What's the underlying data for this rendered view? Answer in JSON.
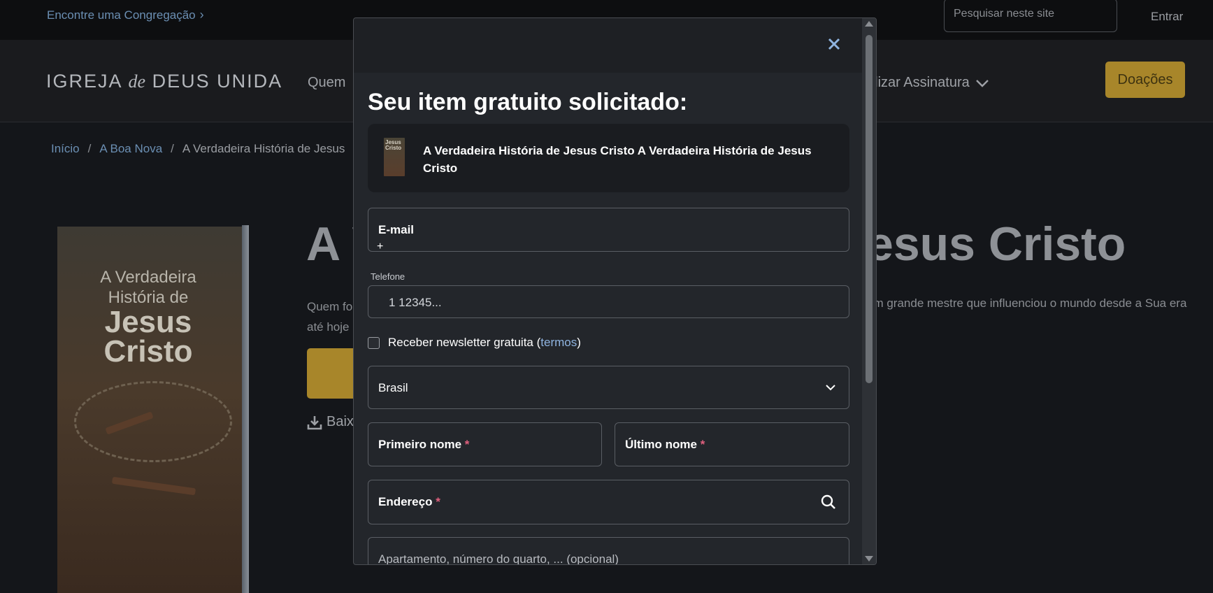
{
  "topbar": {
    "congregation_link": "Encontre uma Congregação",
    "search_placeholder": "Pesquisar neste site",
    "login": "Entrar"
  },
  "nav": {
    "logo_a": "IGREJA",
    "logo_de": "de",
    "logo_b": "DEUS UNIDA",
    "item_quem": "Quem",
    "item_assinatura": "alizar Assinatura",
    "donate": "Doações"
  },
  "breadcrumb": {
    "home": "Início",
    "section": "A Boa Nova",
    "current": "A Verdadeira História de Jesus"
  },
  "page": {
    "book_line1": "A Verdadeira",
    "book_line2": "História de",
    "book_line3": "Jesus",
    "book_line4": "Cristo",
    "title_left": "A V",
    "title_right": "esus Cristo",
    "desc_left_1": "Quem fo",
    "desc_left_2": "até hoje",
    "desc_right": "um grande mestre que influenciou o mundo desde a Sua era",
    "download_text": "Baix"
  },
  "modal": {
    "title": "Seu item gratuito solicitado:",
    "item_thumb_text": "Jesus Cristo",
    "item_name": "A Verdadeira História de Jesus Cristo A Verdadeira História de Jesus Cristo",
    "email_label": "E-mail",
    "phone_label": "Telefone",
    "phone_value": "1 12345...",
    "newsletter_label": "Receber newsletter gratuita (",
    "newsletter_link": "termos",
    "newsletter_close": ")",
    "country_value": "Brasil",
    "first_name_label": "Primeiro nome",
    "last_name_label": "Último nome",
    "address_label": "Endereço",
    "apartment_placeholder": "Apartamento, número do quarto, ... (opcional)",
    "required_mark": "*"
  },
  "colors": {
    "accent_gold": "#a8862a",
    "link_blue": "#6b8fb3",
    "required_pink": "#e0607e",
    "modal_bg": "#23262b"
  }
}
